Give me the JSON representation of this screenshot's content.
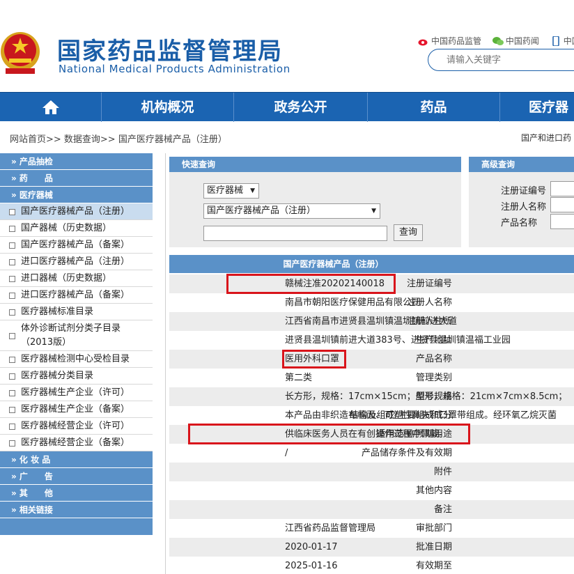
{
  "brand": {
    "cn": "国家药品监督管理局",
    "en": "National Medical Products Administration"
  },
  "toplinks": {
    "weibo": "中国药品监管",
    "wechat": "中国药闻",
    "mobile": "中国"
  },
  "search": {
    "placeholder": "请输入关键字"
  },
  "nav": {
    "home_icon": "home-icon",
    "items": [
      "机构概况",
      "政务公开",
      "药品",
      "医疗器"
    ]
  },
  "breadcrumb": {
    "text": "网站首页>> 数据查询>> 国产医疗器械产品（注册）",
    "right": "国产和进口药"
  },
  "sidebar": {
    "categories": [
      "» 产品抽检",
      "» 药　　品",
      "» 医疗器械",
      "» 化 妆 品",
      "» 广　　告",
      "» 其　　他",
      "» 相关链接"
    ],
    "device_items": [
      "国产医疗器械产品（注册）",
      "国产器械（历史数据）",
      "国产医疗器械产品（备案）",
      "进口医疗器械产品（注册）",
      "进口器械（历史数据）",
      "进口医疗器械产品（备案）",
      "医疗器械标准目录",
      "体外诊断试剂分类子目录（2013版）",
      "医疗器械检测中心受检目录",
      "医疗器械分类目录",
      "医疗器械生产企业（许可）",
      "医疗器械生产企业（备案）",
      "医疗器械经营企业（许可）",
      "医疗器械经营企业（备案）"
    ]
  },
  "quick_query": {
    "title": "快速查询",
    "category_value": "医疗器械",
    "subcategory_value": "国产医疗器械产品（注册）",
    "button": "查询"
  },
  "advanced_query": {
    "title": "高级查询",
    "labels": [
      "注册证编号",
      "注册人名称",
      "产品名称"
    ]
  },
  "detail": {
    "title": "国产医疗器械产品（注册）",
    "rows": [
      {
        "label": "注册证编号",
        "value": "赣械注准20202140018"
      },
      {
        "label": "注册人名称",
        "value": "南昌市朝阳医疗保健用品有限公司"
      },
      {
        "label": "注册人住所",
        "value": "江西省南昌市进贤县温圳镇温圳镇前进大道"
      },
      {
        "label": "生产地址",
        "value": "进贤县温圳镇前进大道383号、进贤县温圳镇温福工业园"
      },
      {
        "label": "产品名称",
        "value": "医用外科口罩"
      },
      {
        "label": "管理类别",
        "value": "第二类"
      },
      {
        "label": "型号规格",
        "value": "长方形，规格：17cm×15cm；船形，规格：21cm×7cm×8.5cm；"
      },
      {
        "label": "结构及组成/主要组成成分",
        "value": "本产品由非织造布幅面、可塑性鼻夹和口罩带组成。经环氧乙烷灭菌"
      },
      {
        "label": "适用范围/预期用途",
        "value": "供临床医务人员在有创操作过程中佩戴。"
      },
      {
        "label": "产品储存条件及有效期",
        "value": "/"
      },
      {
        "label": "附件",
        "value": ""
      },
      {
        "label": "其他内容",
        "value": ""
      },
      {
        "label": "备注",
        "value": ""
      },
      {
        "label": "审批部门",
        "value": "江西省药品监督管理局"
      },
      {
        "label": "批准日期",
        "value": "2020-01-17"
      },
      {
        "label": "有效期至",
        "value": "2025-01-16"
      }
    ]
  },
  "colors": {
    "brand_blue": "#1a5ea8",
    "nav_blue": "#1b64b2",
    "panel_blue": "#5a91c8",
    "highlight_red": "#d9141b"
  }
}
